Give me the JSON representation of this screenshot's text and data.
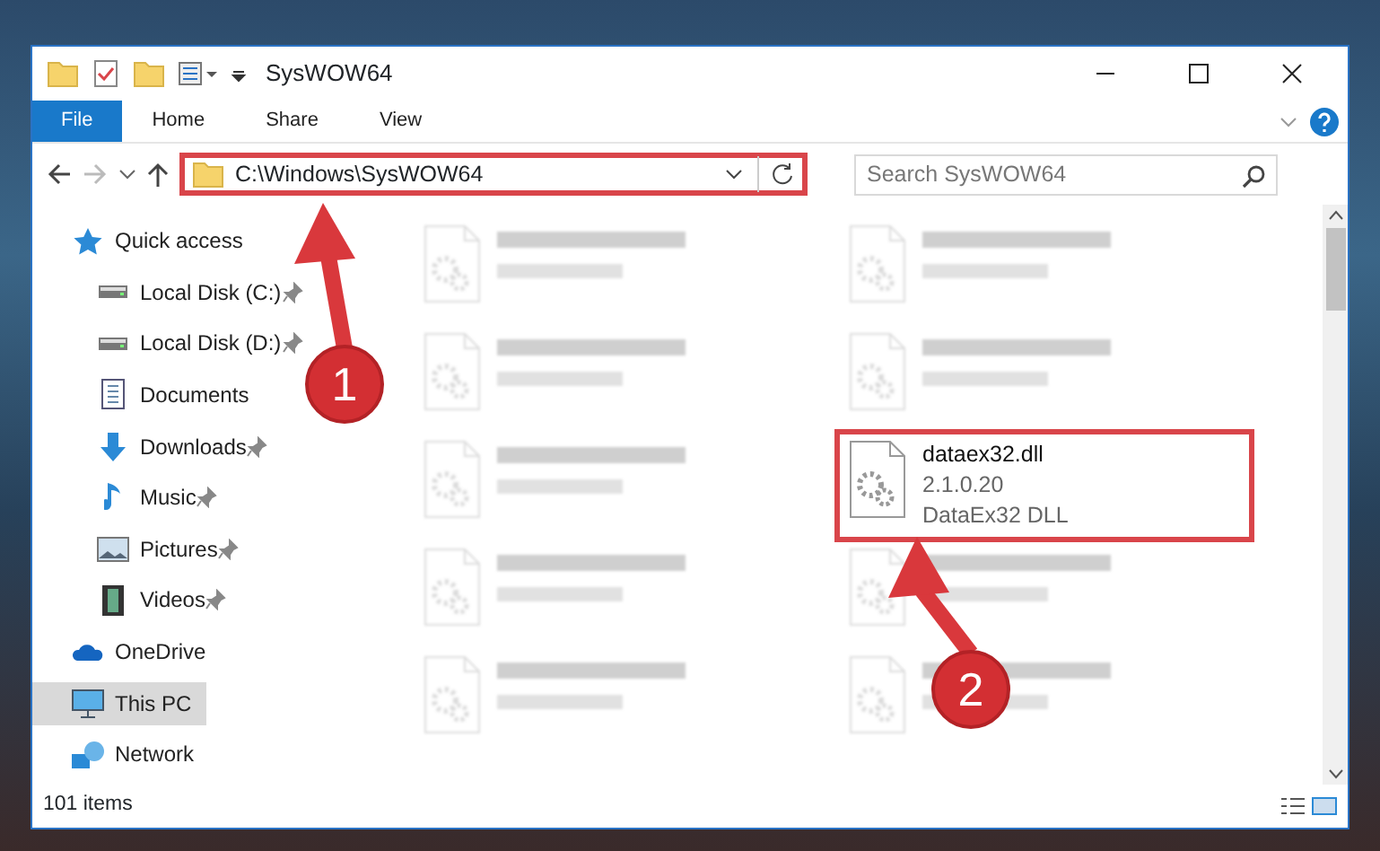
{
  "window": {
    "title": "SysWOW64"
  },
  "ribbon_tabs": [
    {
      "label": "File",
      "selected": true
    },
    {
      "label": "Home",
      "selected": false
    },
    {
      "label": "Share",
      "selected": false
    },
    {
      "label": "View",
      "selected": false
    }
  ],
  "address_bar": {
    "path": "C:\\Windows\\SysWOW64",
    "highlighted": true
  },
  "search": {
    "placeholder": "Search SysWOW64"
  },
  "sidebar": {
    "items": [
      {
        "label": "Quick access",
        "kind": "star",
        "selected": false,
        "children": [
          {
            "label": "Local Disk (C:)",
            "kind": "disk",
            "pinned": true,
            "selected": false
          },
          {
            "label": "Local Disk (D:)",
            "kind": "disk",
            "pinned": true,
            "selected": false
          },
          {
            "label": "Documents",
            "kind": "document",
            "pinned": false,
            "selected": false
          },
          {
            "label": "Downloads",
            "kind": "download",
            "pinned": true,
            "selected": false
          },
          {
            "label": "Music",
            "kind": "music",
            "pinned": true,
            "selected": false
          },
          {
            "label": "Pictures",
            "kind": "picture",
            "pinned": true,
            "selected": false
          },
          {
            "label": "Videos",
            "kind": "video",
            "pinned": true,
            "selected": false
          }
        ]
      },
      {
        "label": "OneDrive",
        "kind": "cloud",
        "selected": false
      },
      {
        "label": "This PC",
        "kind": "pc",
        "selected": true
      },
      {
        "label": "Network",
        "kind": "network",
        "selected": false
      }
    ]
  },
  "files": [
    {
      "kind": "blurred"
    },
    {
      "kind": "blurred"
    },
    {
      "kind": "blurred"
    },
    {
      "kind": "blurred"
    },
    {
      "kind": "blurred"
    },
    {
      "kind": "file",
      "name": "dataex32.dll",
      "lines": [
        "2.1.0.20",
        "DataEx32 DLL"
      ],
      "highlighted": true
    },
    {
      "kind": "blurred"
    },
    {
      "kind": "blurred"
    },
    {
      "kind": "blurred"
    },
    {
      "kind": "blurred"
    }
  ],
  "status_bar": {
    "item_count": "101 items"
  },
  "annotations": [
    {
      "number": "1"
    },
    {
      "number": "2"
    }
  ]
}
